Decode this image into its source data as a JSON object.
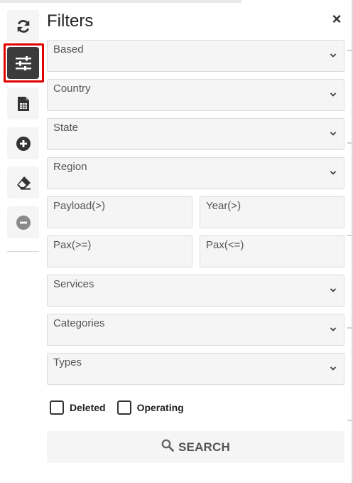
{
  "toolbar": {
    "buttons": [
      {
        "name": "refresh-icon"
      },
      {
        "name": "sliders-icon",
        "active": true
      },
      {
        "name": "spreadsheet-icon"
      },
      {
        "name": "plus-circle-icon"
      },
      {
        "name": "eraser-icon"
      },
      {
        "name": "minus-circle-icon"
      }
    ]
  },
  "panel": {
    "title": "Filters",
    "close_glyph": "×",
    "fields": {
      "based": "Based",
      "country": "Country",
      "state": "State",
      "region": "Region",
      "payload": "Payload(>)",
      "year": "Year(>)",
      "pax_min": "Pax(>=)",
      "pax_max": "Pax(<=)",
      "services": "Services",
      "categories": "Categories",
      "types": "Types"
    },
    "checkboxes": {
      "deleted": "Deleted",
      "operating": "Operating"
    },
    "search_label": "SEARCH"
  },
  "colors": {
    "active_button": "#3b3b3b",
    "highlight_outline": "#e00000",
    "field_bg": "#f5f5f5"
  }
}
